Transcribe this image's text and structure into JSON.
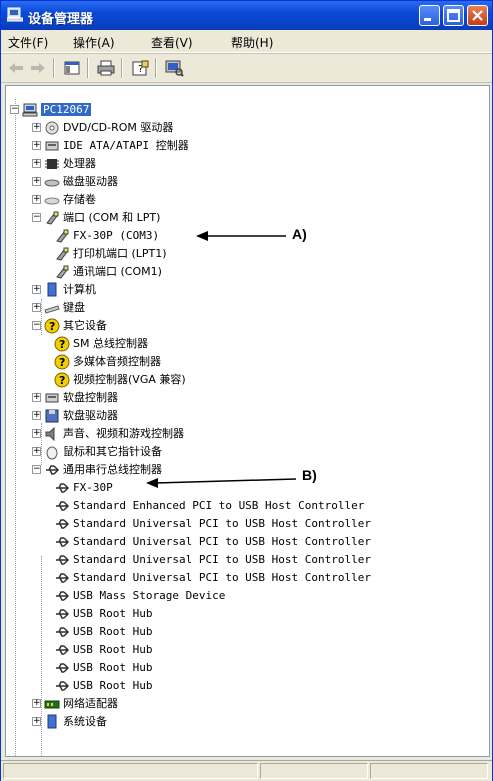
{
  "window": {
    "title": "设备管理器"
  },
  "menu": {
    "file": "文件(F)",
    "action": "操作(A)",
    "view": "查看(V)",
    "help": "帮助(H)"
  },
  "tree": {
    "root": "PC12067",
    "dvd": "DVD/CD-ROM 驱动器",
    "ide": "IDE ATA/ATAPI 控制器",
    "cpu": "处理器",
    "disk": "磁盘驱动器",
    "storage": "存储卷",
    "ports": "端口 (COM 和 LPT)",
    "port_fx": "FX-30P (COM3)",
    "port_lpt": "打印机端口 (LPT1)",
    "port_com1": "通讯端口 (COM1)",
    "computer": "计算机",
    "keyboard": "键盘",
    "other": "其它设备",
    "other_sm": "SM 总线控制器",
    "other_mm": "多媒体音频控制器",
    "other_video": "视频控制器(VGA 兼容)",
    "floppy_ctrl": "软盘控制器",
    "floppy_drv": "软盘驱动器",
    "sound": "声音、视频和游戏控制器",
    "mouse": "鼠标和其它指针设备",
    "usb": "通用串行总线控制器",
    "usb_items": [
      "FX-30P",
      "Standard Enhanced PCI to USB Host Controller",
      "Standard Universal PCI to USB Host Controller",
      "Standard Universal PCI to USB Host Controller",
      "Standard Universal PCI to USB Host Controller",
      "Standard Universal PCI to USB Host Controller",
      "USB Mass Storage Device",
      "USB Root Hub",
      "USB Root Hub",
      "USB Root Hub",
      "USB Root Hub",
      "USB Root Hub"
    ],
    "network": "网络适配器",
    "system": "系统设备"
  },
  "annotations": {
    "a": "A)",
    "b": "B)"
  }
}
